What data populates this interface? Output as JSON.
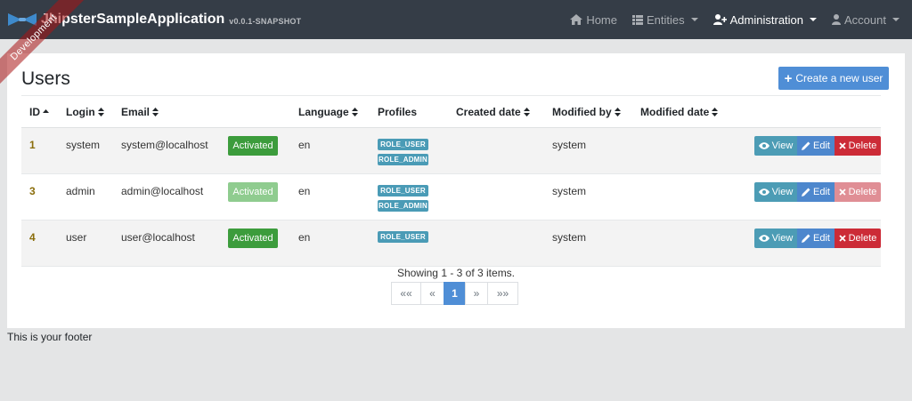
{
  "brand": {
    "name": "JhipsterSampleApplication",
    "version": "v0.0.1-SNAPSHOT"
  },
  "ribbon": "Development",
  "nav": {
    "home": "Home",
    "entities": "Entities",
    "administration": "Administration",
    "account": "Account"
  },
  "page": {
    "title": "Users",
    "create_button": "Create a new user"
  },
  "table": {
    "headers": {
      "id": "ID",
      "login": "Login",
      "email": "Email",
      "language": "Language",
      "profiles": "Profiles",
      "created_date": "Created date",
      "modified_by": "Modified by",
      "modified_date": "Modified date"
    },
    "rows": [
      {
        "id": "1",
        "login": "system",
        "email": "system@localhost",
        "status": "Activated",
        "language": "en",
        "profiles": [
          "ROLE_USER",
          "ROLE_ADMIN"
        ],
        "created_date": "",
        "modified_by": "system",
        "modified_date": ""
      },
      {
        "id": "3",
        "login": "admin",
        "email": "admin@localhost",
        "status": "Activated",
        "language": "en",
        "profiles": [
          "ROLE_USER",
          "ROLE_ADMIN"
        ],
        "created_date": "",
        "modified_by": "system",
        "modified_date": ""
      },
      {
        "id": "4",
        "login": "user",
        "email": "user@localhost",
        "status": "Activated",
        "language": "en",
        "profiles": [
          "ROLE_USER"
        ],
        "created_date": "",
        "modified_by": "system",
        "modified_date": ""
      }
    ],
    "actions": {
      "view": "View",
      "edit": "Edit",
      "delete": "Delete"
    }
  },
  "pagination": {
    "summary": "Showing 1 - 3 of 3 items.",
    "first": "««",
    "prev": "«",
    "current": "1",
    "next": "»",
    "last": "»»"
  },
  "footer": "This is your footer",
  "colors": {
    "navbar": "#353d47",
    "primary": "#4f8ed6",
    "success": "#3c9c3c",
    "info": "#4c9cb5",
    "danger": "#cc2b37"
  }
}
